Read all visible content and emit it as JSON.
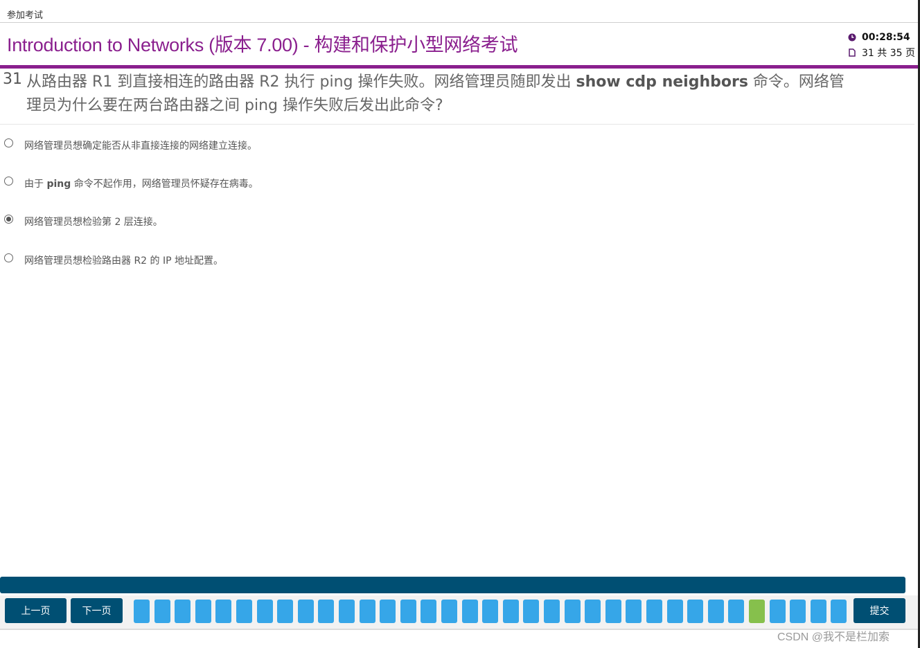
{
  "topbar": {
    "label": "参加考试"
  },
  "header": {
    "title": "Introduction to Networks (版本 7.00) - 构建和保护小型网络考试",
    "timer": "00:28:54",
    "page_counter": "31 共 35 页",
    "timer_icon": "clock-icon",
    "page_icon": "document-icon",
    "accent_color": "#8a1f8e"
  },
  "question": {
    "number": "31",
    "text_before": "从路由器 R1 到直接相连的路由器 R2 执行 ping 操作失败。网络管理员随即发出 ",
    "command": "show cdp neighbors",
    "text_after": " 命令。网络管理员为什么要在两台路由器之间 ping 操作失败后发出此命令?"
  },
  "options": [
    {
      "text": "网络管理员想确定能否从非直接连接的网络建立连接。",
      "selected": false
    },
    {
      "prefix": "由于 ",
      "bold": "ping",
      "text": " 命令不起作用，网络管理员怀疑存在病毒。",
      "selected": false
    },
    {
      "text": "网络管理员想检验第 2 层连接。",
      "selected": true
    },
    {
      "text": "网络管理员想检验路由器 R2 的 IP 地址配置。",
      "selected": false
    }
  ],
  "navigation": {
    "prev_label": "上一页",
    "next_label": "下一页",
    "submit_label": "提交",
    "question_count": 35,
    "current_question": 31,
    "box_color": "#36a6e8",
    "current_color": "#86c04c",
    "bar_color": "#004f73"
  },
  "watermark": "CSDN @我不是栏加索"
}
